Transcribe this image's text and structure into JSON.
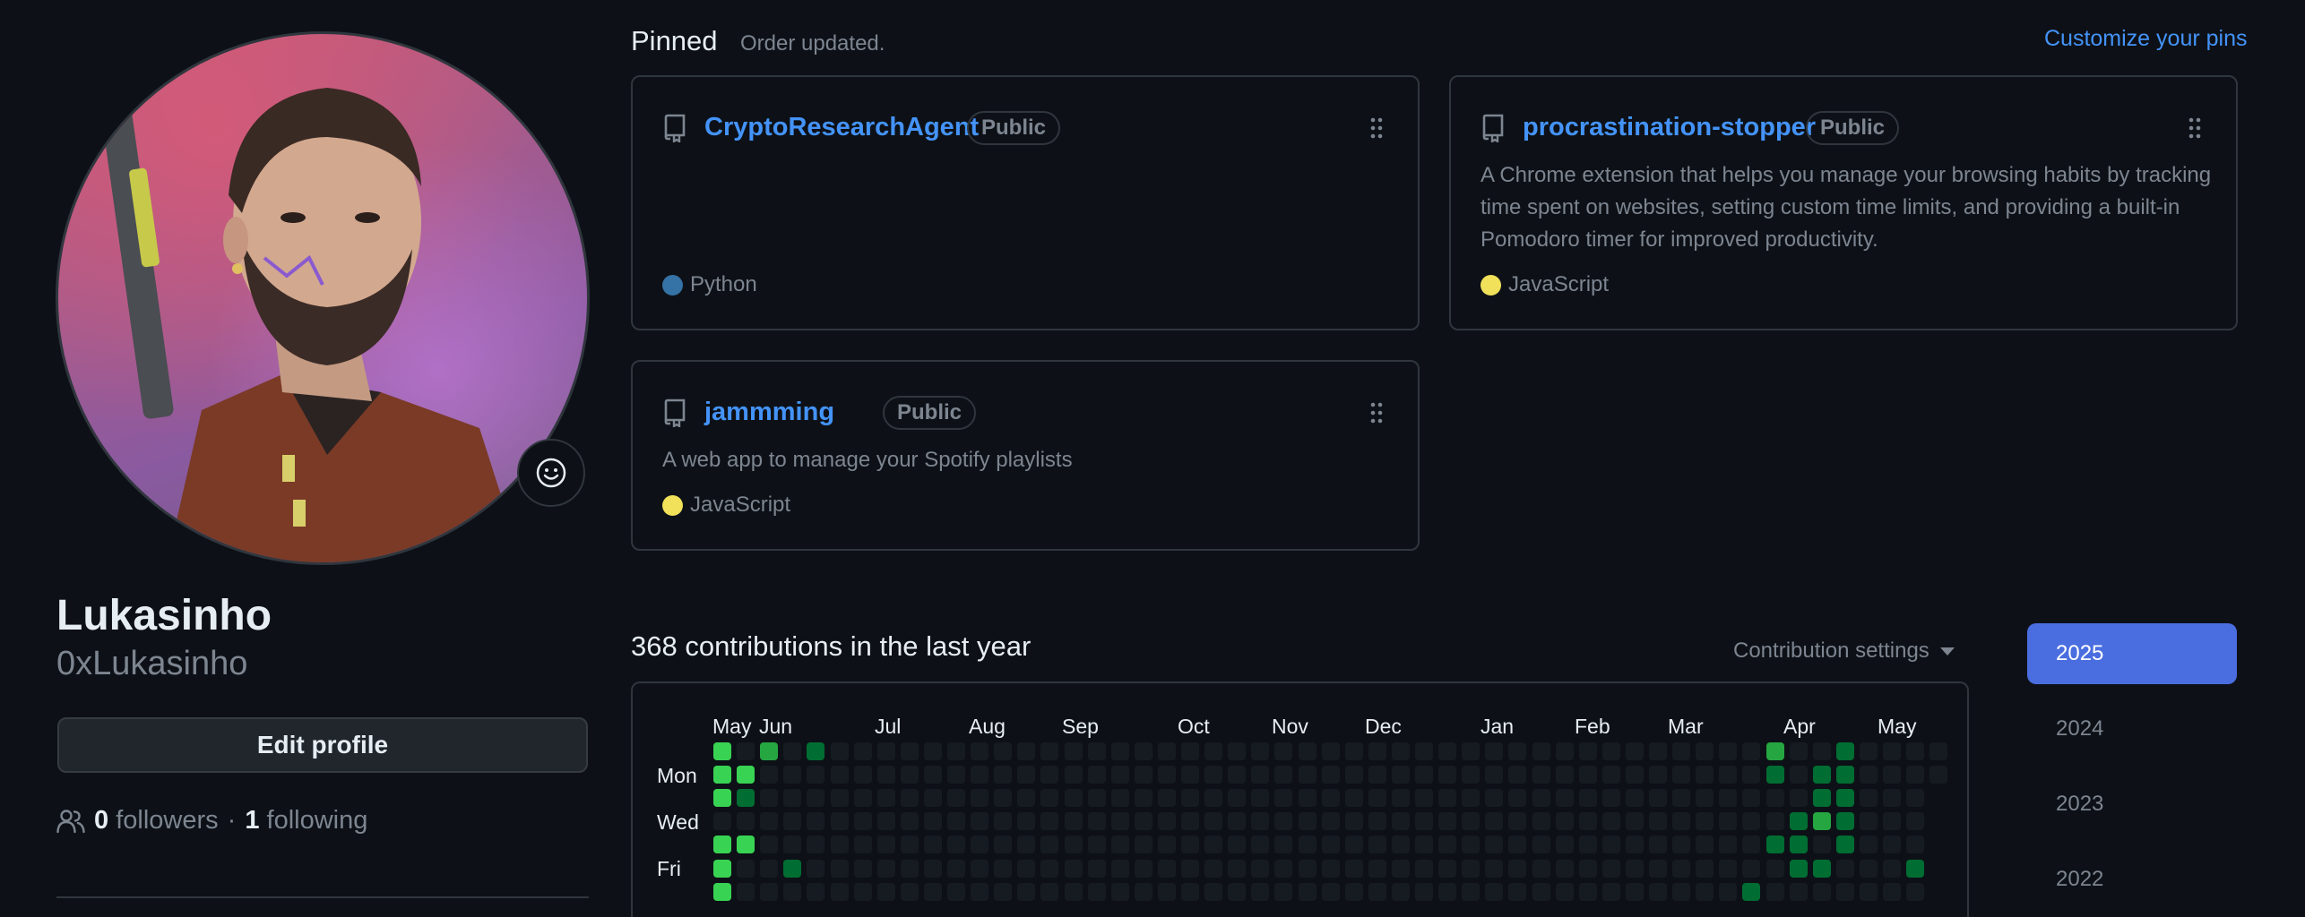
{
  "profile": {
    "name": "Lukasinho",
    "login": "0xLukasinho",
    "edit_label": "Edit profile",
    "followers_count": "0",
    "followers_label": "followers",
    "separator": "·",
    "following_count": "1",
    "following_label": "following"
  },
  "pinned": {
    "title": "Pinned",
    "note": "Order updated.",
    "customize_label": "Customize your pins",
    "repos": [
      {
        "name": "CryptoResearchAgent",
        "visibility": "Public",
        "description": "",
        "language": "Python",
        "language_color": "#3572A5"
      },
      {
        "name": "procrastination-stopper",
        "visibility": "Public",
        "description": "A Chrome extension that helps you manage your browsing habits by tracking time spent on websites, setting custom time limits, and providing a built-in Pomodoro timer for improved productivity.",
        "language": "JavaScript",
        "language_color": "#f1e05a"
      },
      {
        "name": "jammming",
        "visibility": "Public",
        "description": "A web app to manage your Spotify playlists",
        "language": "JavaScript",
        "language_color": "#f1e05a"
      }
    ]
  },
  "contributions": {
    "title": "368 contributions in the last year",
    "settings_label": "Contribution settings",
    "months": [
      "May",
      "Jun",
      "Jul",
      "Aug",
      "Sep",
      "Oct",
      "Nov",
      "Dec",
      "Jan",
      "Feb",
      "Mar",
      "Apr",
      "May"
    ],
    "days": [
      "Mon",
      "Wed",
      "Fri"
    ],
    "colors": {
      "level0": "#161b22",
      "level1": "#0e4429",
      "level2": "#006d32",
      "level3": "#26a641",
      "level4": "#39d353"
    }
  },
  "years": [
    "2025",
    "2024",
    "2023",
    "2022"
  ],
  "accent_color": "#4493f8"
}
